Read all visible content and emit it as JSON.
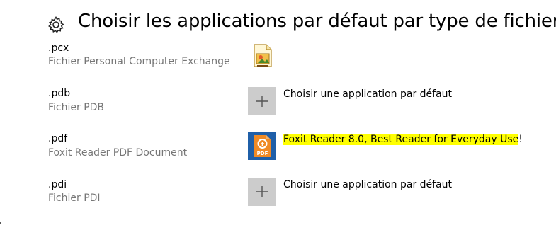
{
  "header": {
    "title": "Choisir les applications par défaut par type de fichier",
    "icon": "gear-icon"
  },
  "rows": [
    {
      "ext": ".pcx",
      "desc": "Fichier Personal Computer Exchange",
      "app_icon": "paint-image-icon",
      "app_label": ""
    },
    {
      "ext": ".pdb",
      "desc": "Fichier PDB",
      "app_icon": "plus-icon",
      "app_label": "Choisir une application par défaut"
    },
    {
      "ext": ".pdf",
      "desc": "Foxit Reader PDF Document",
      "app_icon": "foxit-pdf-icon",
      "app_label_highlighted": "Foxit Reader 8.0, Best Reader for Everyday Use",
      "app_label_suffix": "!",
      "highlight_color": "#ffff00"
    },
    {
      "ext": ".pdi",
      "desc": "Fichier PDI",
      "app_icon": "plus-icon",
      "app_label": "Choisir une application par défaut"
    }
  ],
  "colors": {
    "secondary_text": "#767676",
    "tile_gray": "#cccccc",
    "foxit_orange": "#f08a24",
    "foxit_blue": "#1f5fa8"
  }
}
